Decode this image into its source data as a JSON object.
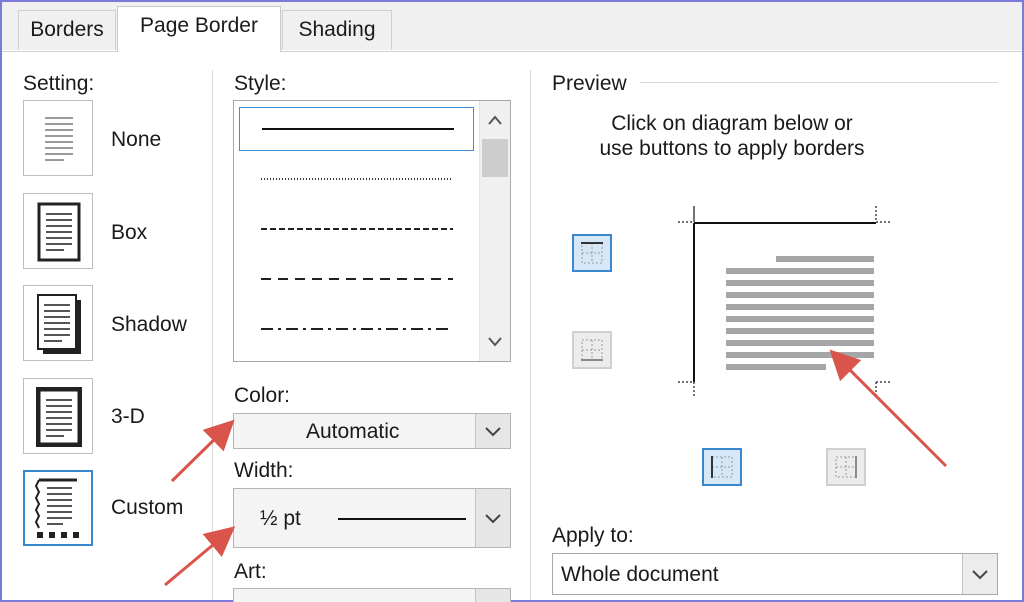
{
  "tabs": [
    {
      "label": "Borders",
      "active": false
    },
    {
      "label": "Page Border",
      "active": true
    },
    {
      "label": "Shading",
      "active": false
    }
  ],
  "setting": {
    "label": "Setting:",
    "options": [
      {
        "label": "None",
        "selected": false
      },
      {
        "label": "Box",
        "selected": false
      },
      {
        "label": "Shadow",
        "selected": false
      },
      {
        "label": "3-D",
        "selected": false
      },
      {
        "label": "Custom",
        "selected": true
      }
    ]
  },
  "style": {
    "label": "Style:",
    "items": [
      "solid",
      "dotted",
      "dashed-fine",
      "dashed",
      "dash-dot"
    ],
    "selected_index": 0
  },
  "color": {
    "label": "Color:",
    "value": "Automatic"
  },
  "width": {
    "label": "Width:",
    "value": "½ pt"
  },
  "art": {
    "label": "Art:"
  },
  "preview": {
    "label": "Preview",
    "instruction_line1": "Click on diagram below or",
    "instruction_line2": "use buttons to apply borders",
    "buttons": [
      {
        "name": "top-border",
        "on": true
      },
      {
        "name": "bottom-border",
        "on": false
      },
      {
        "name": "left-border",
        "on": true
      },
      {
        "name": "right-border",
        "on": false
      }
    ]
  },
  "apply_to": {
    "label": "Apply to:",
    "value": "Whole document"
  },
  "colors": {
    "accent": "#3a87cf",
    "annotation_arrow": "#d9544a",
    "frame": "#7a7ad8"
  },
  "icons": [
    "chevron-up",
    "chevron-down",
    "border-top",
    "border-bottom",
    "border-left",
    "border-right"
  ]
}
